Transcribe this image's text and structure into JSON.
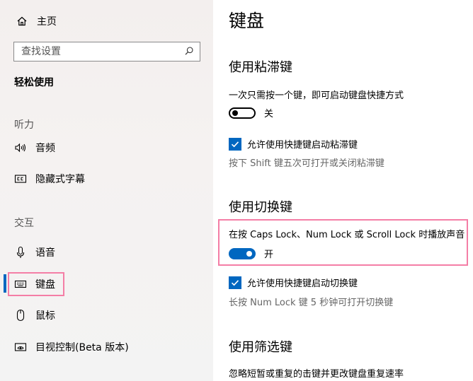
{
  "sidebar": {
    "home_label": "主页",
    "search_placeholder": "查找设置",
    "section_title": "轻松使用",
    "group_hearing": "听力",
    "item_audio": "音频",
    "item_captions": "隐藏式字幕",
    "group_interaction": "交互",
    "item_speech": "语音",
    "item_keyboard": "键盘",
    "item_mouse": "鼠标",
    "item_eye_control": "目视控制(Beta 版本)"
  },
  "main": {
    "title": "键盘",
    "sticky": {
      "header": "使用粘滞键",
      "desc": "一次只需按一个键，即可启动键盘快捷方式",
      "toggle_state": "关",
      "checkbox_label": "允许使用快捷键启动粘滞键",
      "hint": "按下 Shift 键五次可打开或关闭粘滞键"
    },
    "toggle_keys": {
      "header": "使用切换键",
      "desc": "在按 Caps Lock、Num Lock 或 Scroll Lock 时播放声音",
      "toggle_state": "开",
      "checkbox_label": "允许使用快捷键启动切换键",
      "hint": "长按 Num Lock 键 5 秒钟可打开切换键"
    },
    "filter": {
      "header": "使用筛选键",
      "desc": "忽略短暂或重复的击键并更改键盘重复速率"
    }
  },
  "colors": {
    "accent": "#0067c0",
    "highlight": "#f47ea6",
    "sidebar_bg": "#f4f1f0"
  },
  "icons": [
    "home-icon",
    "search-icon",
    "speaker-icon",
    "captions-icon",
    "microphone-icon",
    "keyboard-icon",
    "mouse-icon",
    "eye-control-icon",
    "check-icon"
  ]
}
